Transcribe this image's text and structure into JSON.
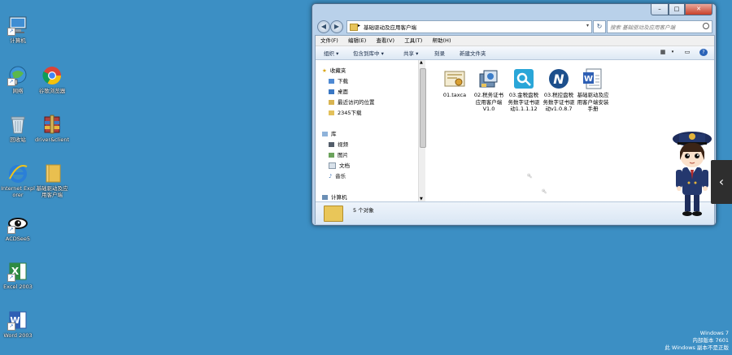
{
  "desktop": {
    "icons": [
      {
        "label": "计算机",
        "icon": "computer-icon"
      },
      {
        "label": "网络",
        "icon": "network-icon"
      },
      {
        "label": "谷歌浏览器",
        "icon": "chrome-icon"
      },
      {
        "label": "回收站",
        "icon": "recycle-bin-icon"
      },
      {
        "label": "driver&client",
        "icon": "winrar-archive-icon"
      },
      {
        "label": "Internet Explorer",
        "icon": "internet-explorer-icon"
      },
      {
        "label": "基础驱动及应用客户端",
        "icon": "folder-icon"
      },
      {
        "label": "ACDSee5",
        "icon": "acdsee-icon"
      },
      {
        "label": "Excel 2003",
        "icon": "excel-icon"
      },
      {
        "label": "Word 2003",
        "icon": "word-icon"
      }
    ]
  },
  "explorer": {
    "address_path": "基础驱动及应用客户端",
    "search_placeholder": "搜索 基础驱动及应用客户端",
    "menu": [
      "文件(F)",
      "编辑(E)",
      "查看(V)",
      "工具(T)",
      "帮助(H)"
    ],
    "toolbar": [
      "组织 ▾",
      "包含到库中 ▾",
      "共享 ▾",
      "刻录",
      "新建文件夹"
    ],
    "nav": {
      "favorites": "收藏夹",
      "favorite_items": [
        "下载",
        "桌面",
        "最近访问的位置",
        "2345下载"
      ],
      "libraries": "库",
      "library_items": [
        "视频",
        "图片",
        "文档",
        "音乐"
      ],
      "computer": "计算机"
    },
    "files": [
      {
        "name": "01.taxca",
        "icon": "certificate-file-icon"
      },
      {
        "name": "02.税务证书应用客户端V1.0",
        "icon": "installer-package-icon"
      },
      {
        "name": "03.金税盘税务数字证书驱动1.1.1.12",
        "icon": "key-driver-icon"
      },
      {
        "name": "03.税控盘税务数字证书驱动v1.0.8.7",
        "icon": "n-driver-icon"
      },
      {
        "name": "基础驱动及应用客户端安装手册",
        "icon": "word-document-icon"
      }
    ],
    "status": "5 个对象"
  },
  "watermark": {
    "line1": "Windows 7",
    "line2": "内部版本 7601",
    "line3": "此 Windows 副本不是正版"
  },
  "colors": {
    "desktop": "#3c8fc4",
    "window_frame": "#b9d1ea",
    "close_button": "#c8402a"
  }
}
